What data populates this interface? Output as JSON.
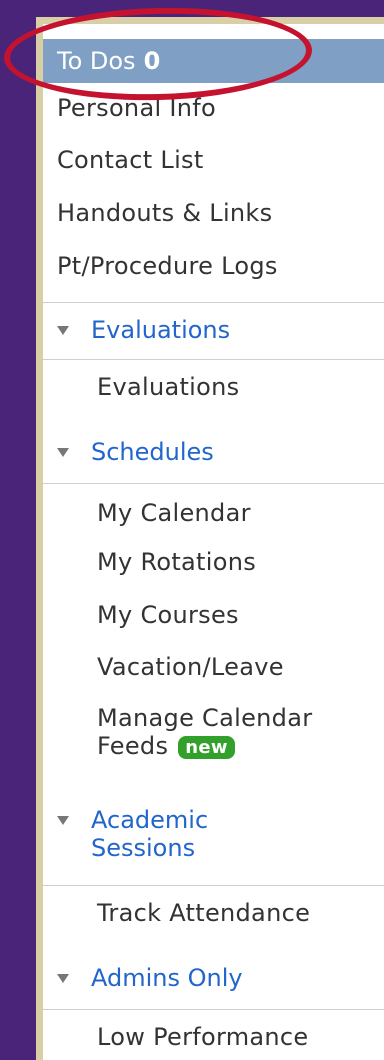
{
  "menu": {
    "todos_label": "To Dos",
    "todos_count": "0",
    "top_items": [
      "Personal Info",
      "Contact List",
      "Handouts & Links",
      "Pt/Procedure Logs"
    ],
    "evaluations": {
      "header": "Evaluations",
      "items": [
        "Evaluations"
      ]
    },
    "schedules": {
      "header": "Schedules",
      "items": [
        "My Calendar",
        "My Rotations",
        "My Courses",
        "Vacation/Leave"
      ],
      "manage_line1": "Manage Calendar",
      "manage_line2": "Feeds",
      "badge": "new"
    },
    "academic": {
      "header_line1": "Academic",
      "header_line2": "Sessions",
      "items": [
        "Track Attendance"
      ]
    },
    "admins": {
      "header": "Admins Only",
      "items": [
        "Low Performance"
      ]
    }
  },
  "colors": {
    "background": "#4a2478",
    "active_item": "#7f9fc4",
    "section_link": "#2266cc",
    "badge": "#33a02c",
    "highlight_ring": "#c4122f"
  }
}
